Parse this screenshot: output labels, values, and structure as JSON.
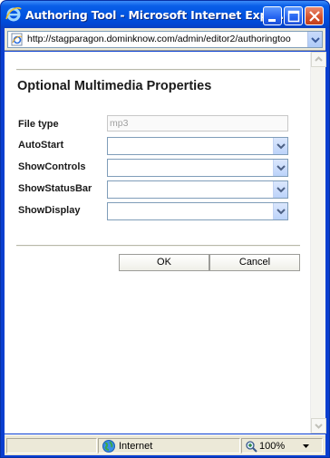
{
  "window": {
    "title": "Authoring Tool - Microsoft Internet Expl..."
  },
  "address_bar": {
    "url": "http://stagparagon.dominknow.com/admin/editor2/authoringtoo"
  },
  "dialog": {
    "heading": "Optional Multimedia Properties",
    "fields": [
      {
        "label": "File type",
        "value": "mp3"
      },
      {
        "label": "AutoStart",
        "value": ""
      },
      {
        "label": "ShowControls",
        "value": ""
      },
      {
        "label": "ShowStatusBar",
        "value": ""
      },
      {
        "label": "ShowDisplay",
        "value": ""
      }
    ],
    "ok_label": "OK",
    "cancel_label": "Cancel"
  },
  "status_bar": {
    "zone": "Internet",
    "zoom": "100%"
  },
  "colors": {
    "titlebar": "#0052e0",
    "chrome": "#ece9d8",
    "close_button": "#d4502a"
  }
}
